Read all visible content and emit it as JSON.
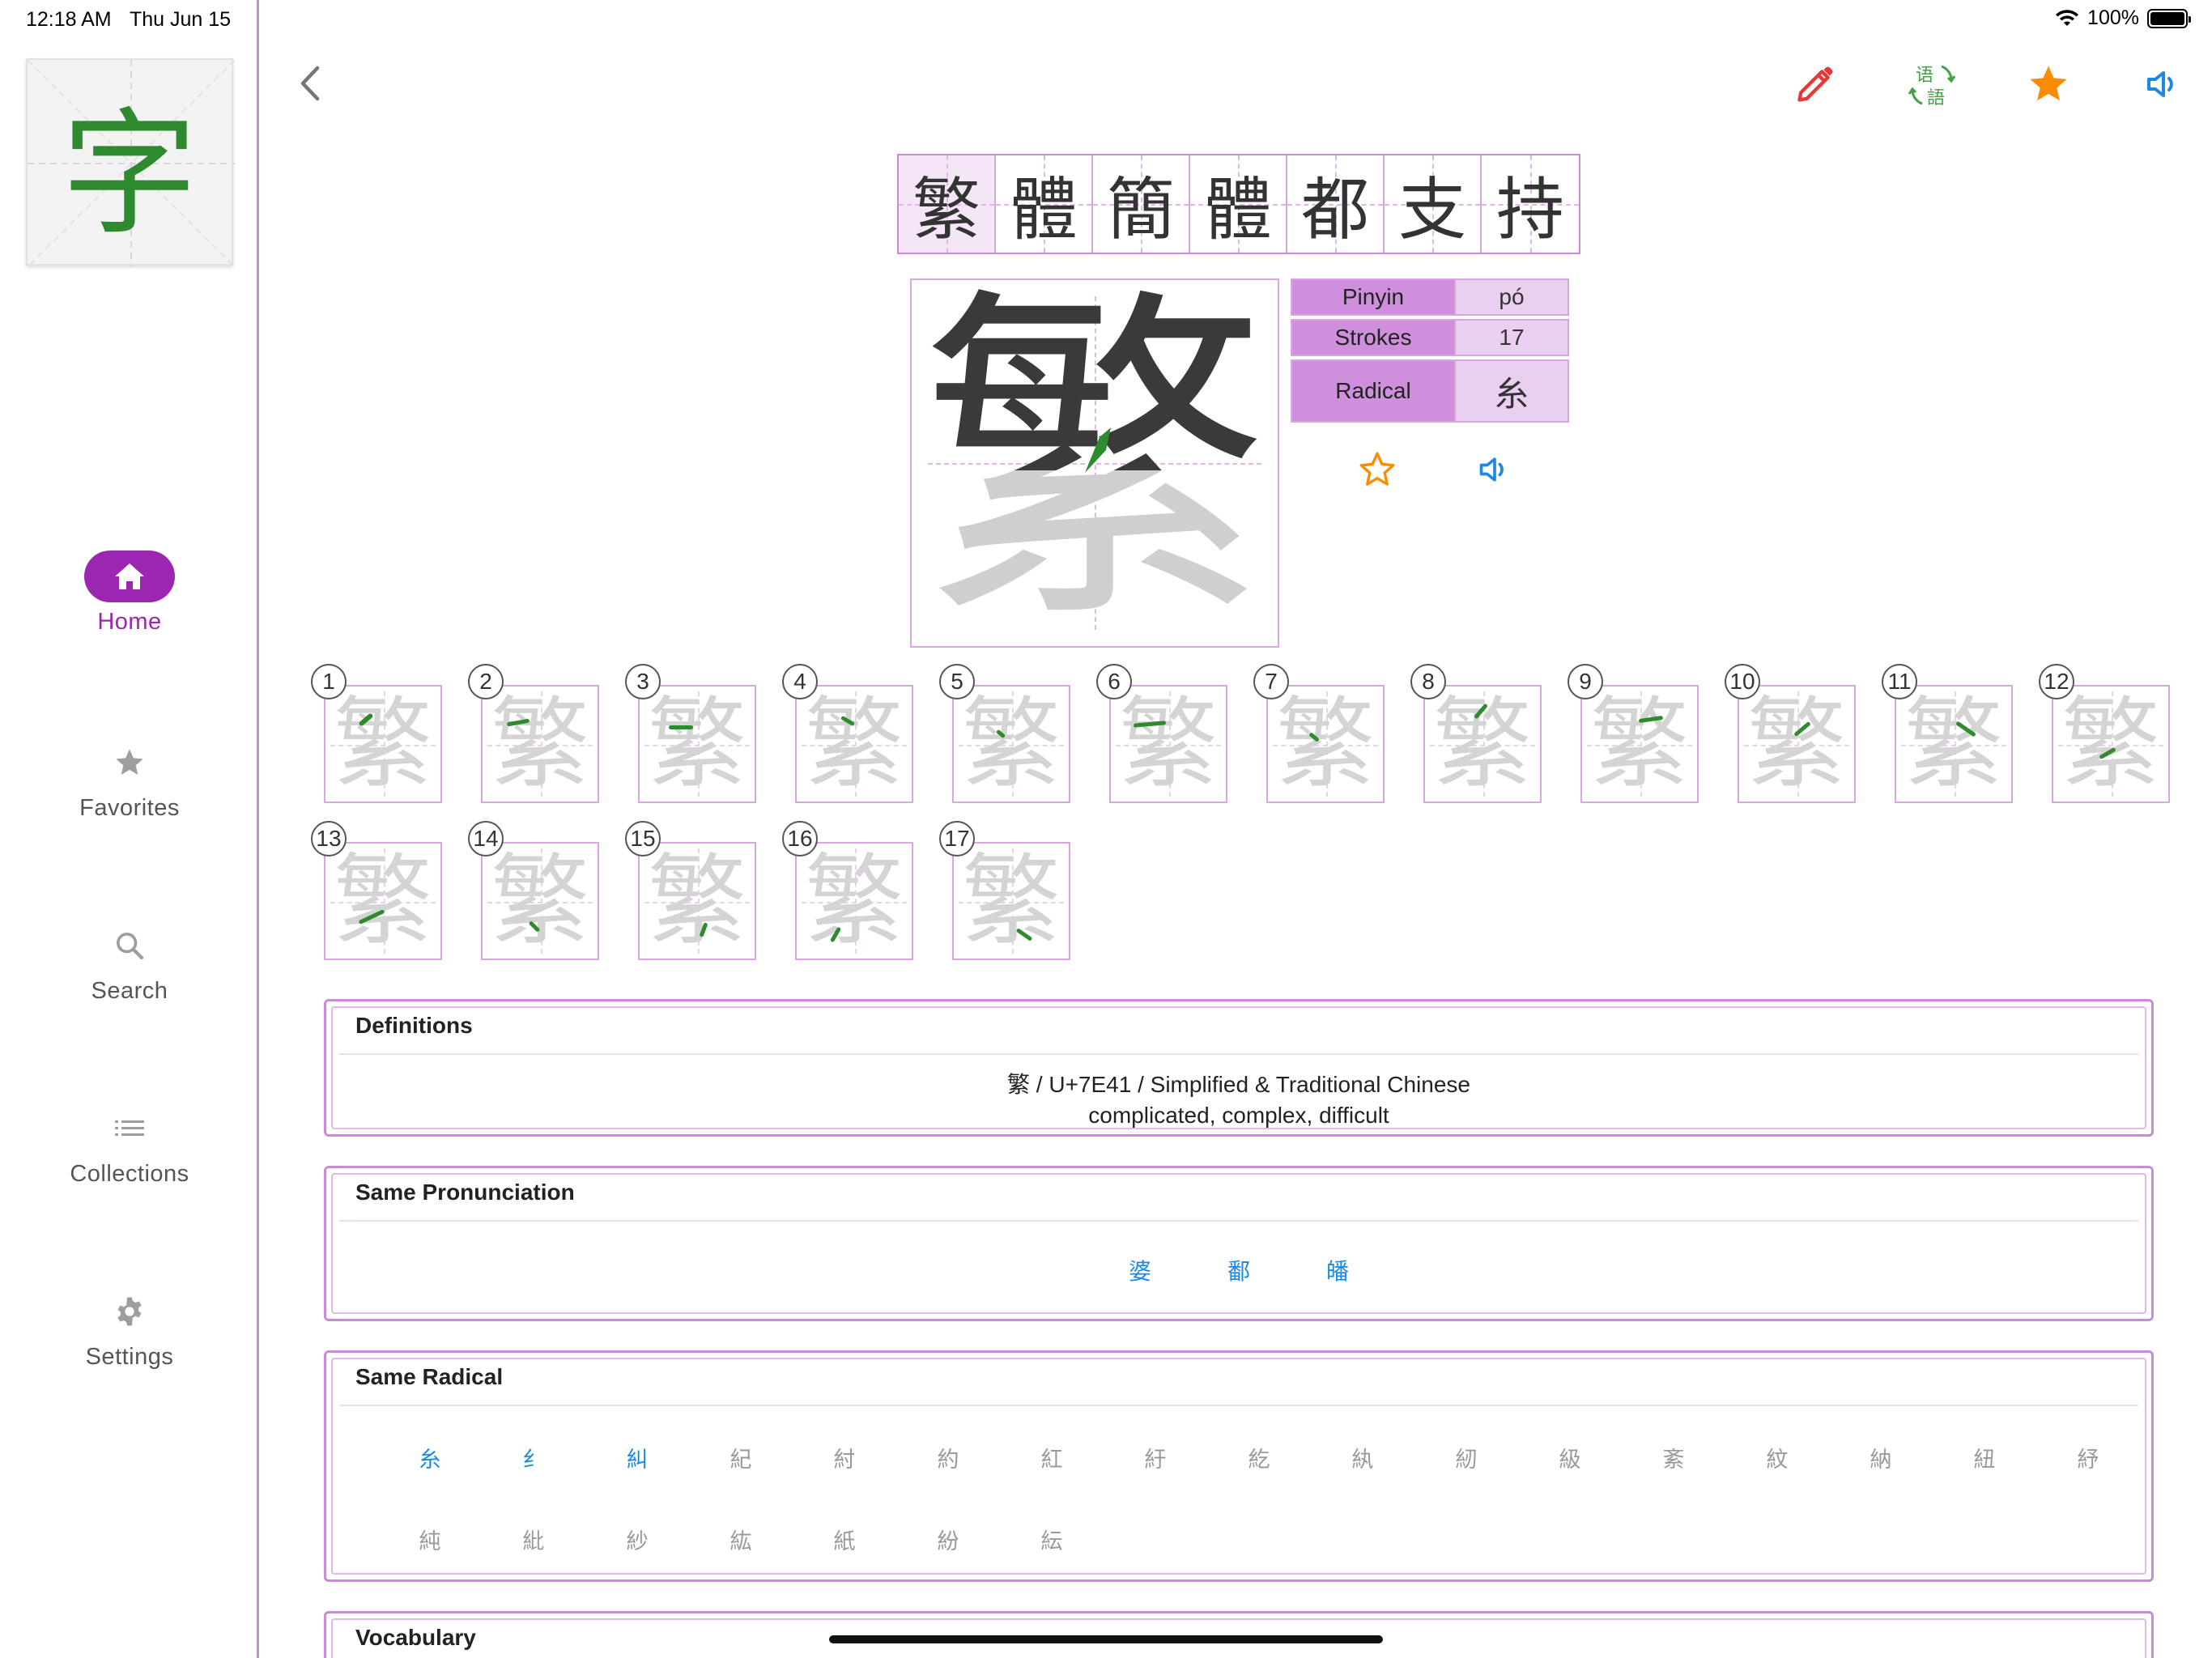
{
  "status_bar": {
    "time": "12:18 AM",
    "date": "Thu Jun 15",
    "battery": "100%"
  },
  "sidebar": {
    "logo_char": "字",
    "items": [
      {
        "label": "Home",
        "icon": "home-icon",
        "active": true
      },
      {
        "label": "Favorites",
        "icon": "star-icon",
        "active": false
      },
      {
        "label": "Search",
        "icon": "search-icon",
        "active": false
      },
      {
        "label": "Collections",
        "icon": "list-icon",
        "active": false
      },
      {
        "label": "Settings",
        "icon": "gear-icon",
        "active": false
      }
    ]
  },
  "toolbar": {
    "icons": [
      "back-chevron-icon",
      "pencil-icon",
      "language-convert-icon",
      "favorite-star-icon",
      "speaker-icon"
    ],
    "language_icon_text": "语語"
  },
  "header_chars": [
    "繁",
    "體",
    "簡",
    "體",
    "都",
    "支",
    "持"
  ],
  "character": {
    "glyph": "繁",
    "pinyin_label": "Pinyin",
    "pinyin": "pó",
    "strokes_label": "Strokes",
    "strokes": "17",
    "radical_label": "Radical",
    "radical": "糸"
  },
  "stroke_order": {
    "glyph": "繁",
    "numbers": [
      "1",
      "2",
      "3",
      "4",
      "5",
      "6",
      "7",
      "8",
      "9",
      "10",
      "11",
      "12",
      "13",
      "14",
      "15",
      "16",
      "17"
    ]
  },
  "definitions": {
    "title": "Definitions",
    "line1": "繁 / U+7E41 / Simplified & Traditional Chinese",
    "line2": "complicated, complex, difficult"
  },
  "same_pronunciation": {
    "title": "Same Pronunciation",
    "chars": [
      "婆",
      "鄱",
      "皤"
    ]
  },
  "same_radical": {
    "title": "Same Radical",
    "chars": [
      "糸",
      "纟",
      "糾",
      "紀",
      "紂",
      "約",
      "紅",
      "紆",
      "紇",
      "紈",
      "紉",
      "級",
      "紊",
      "紋",
      "納",
      "紐",
      "紓",
      "純",
      "紕",
      "紗",
      "紘",
      "紙",
      "紛",
      "紜"
    ],
    "linked_count": 3
  },
  "vocabulary": {
    "title": "Vocabulary"
  },
  "colors": {
    "accent": "#9b27b0",
    "border": "#c98ad6",
    "link": "#1e88e5",
    "stroke_green": "#2e8b2e"
  }
}
